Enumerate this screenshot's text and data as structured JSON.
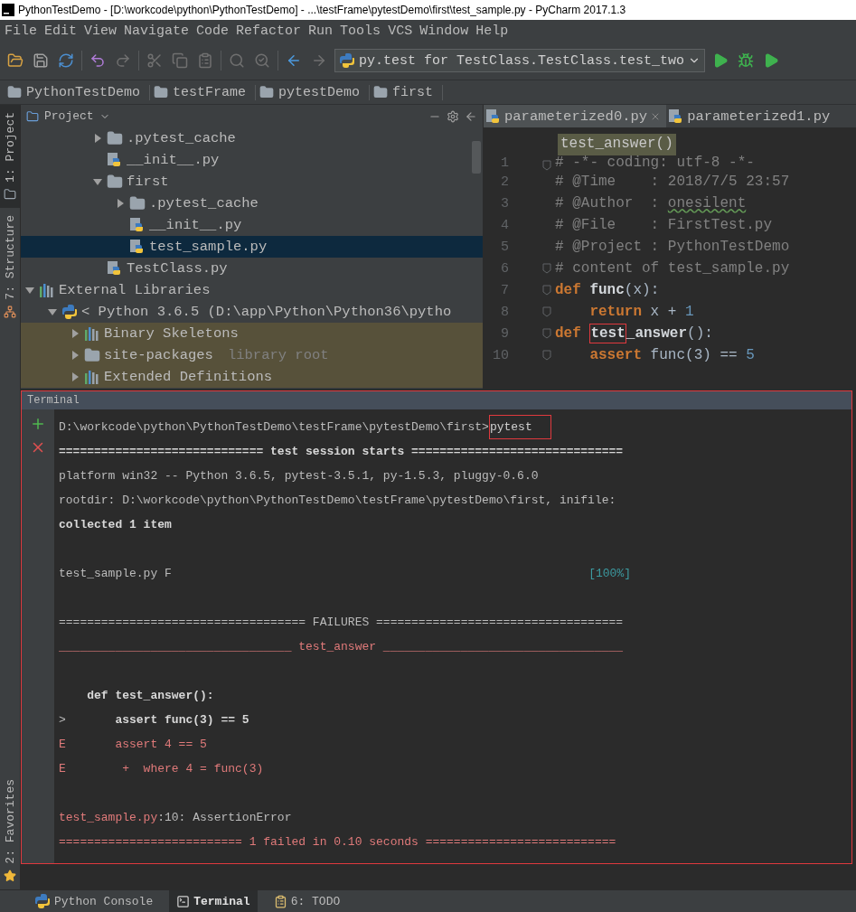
{
  "window": {
    "title": "PythonTestDemo - [D:\\workcode\\python\\PythonTestDemo] - ...\\testFrame\\pytestDemo\\first\\test_sample.py - PyCharm 2017.1.3"
  },
  "menu": [
    "File",
    "Edit",
    "View",
    "Navigate",
    "Code",
    "Refactor",
    "Run",
    "Tools",
    "VCS",
    "Window",
    "Help"
  ],
  "toolbar": {
    "run_config": "py.test for TestClass.TestClass.test_two"
  },
  "breadcrumbs": [
    "PythonTestDemo",
    "testFrame",
    "pytestDemo",
    "first"
  ],
  "side_tabs": [
    {
      "label": "1: Project",
      "selected": true
    },
    {
      "label": "7: Structure",
      "selected": false
    },
    {
      "label": "2: Favorites",
      "selected": false
    }
  ],
  "project": {
    "title": "Project",
    "tree": [
      {
        "children": [
          {
            "children": [
              {
                "children": [
                  {
                    "label": ".pytest_cache",
                    "kind": "folder",
                    "expanded": false,
                    "selected": false,
                    "shaded": false
                  },
                  {
                    "label": "__init__.py",
                    "kind": "python",
                    "selected": false,
                    "shaded": false
                  },
                  {
                    "label": "first",
                    "kind": "package",
                    "expanded": true,
                    "selected": false,
                    "shaded": false,
                    "children": [
                      {
                        "label": ".pytest_cache",
                        "kind": "folder",
                        "expanded": false,
                        "selected": false,
                        "shaded": false
                      },
                      {
                        "label": "__init__.py",
                        "kind": "python",
                        "selected": false,
                        "shaded": false
                      },
                      {
                        "label": "test_sample.py",
                        "kind": "python",
                        "selected": true,
                        "shaded": false
                      }
                    ]
                  },
                  {
                    "label": "TestClass.py",
                    "kind": "python",
                    "selected": false,
                    "shaded": false
                  }
                ]
              }
            ]
          }
        ]
      },
      {
        "label": "External Libraries",
        "kind": "libraries",
        "expanded": true,
        "selected": false,
        "shaded": false,
        "children": [
          {
            "label": "< Python 3.6.5 (D:\\app\\Python\\Python36\\pytho",
            "kind": "sdk",
            "expanded": true,
            "selected": false,
            "shaded": false,
            "children": [
              {
                "label": "Binary Skeletons",
                "kind": "libraries",
                "expanded": false,
                "selected": false,
                "shaded": true
              },
              {
                "label": "site-packages",
                "note": "library root",
                "kind": "folder",
                "expanded": false,
                "selected": false,
                "shaded": true
              },
              {
                "label": "Extended Definitions",
                "kind": "libraries",
                "expanded": false,
                "selected": false,
                "shaded": true
              }
            ]
          }
        ]
      }
    ]
  },
  "editor": {
    "tabs": [
      {
        "label": "parameterized0.py",
        "selected": true
      },
      {
        "label": "parameterized1.py",
        "selected": false
      }
    ],
    "sticky_header": "test_answer()",
    "lines": [
      {
        "number": "1",
        "fold": true,
        "clipped": true,
        "segments": [
          {
            "text": "# -*- coding: utf-8 -*-",
            "kind": "comment"
          }
        ]
      },
      {
        "number": "2",
        "fold": false,
        "clipped": false,
        "segments": [
          {
            "text": "# @Time    : 2018/7/5 23:57",
            "kind": "comment"
          }
        ]
      },
      {
        "number": "3",
        "fold": false,
        "clipped": false,
        "segments": [
          {
            "text": "# @Author  : ",
            "kind": "comment"
          },
          {
            "text": "onesilent",
            "kind": "typo"
          }
        ]
      },
      {
        "number": "4",
        "fold": false,
        "clipped": false,
        "segments": [
          {
            "text": "# @File    : FirstTest.py",
            "kind": "comment"
          }
        ]
      },
      {
        "number": "5",
        "fold": false,
        "clipped": false,
        "segments": [
          {
            "text": "# @Project : PythonTestDemo",
            "kind": "comment"
          }
        ]
      },
      {
        "number": "6",
        "fold": true,
        "clipped": false,
        "segments": [
          {
            "text": "# content of test_sample.py",
            "kind": "comment"
          }
        ]
      },
      {
        "number": "7",
        "fold": true,
        "clipped": false,
        "segments": [
          {
            "text": "def",
            "kind": "keyword"
          },
          {
            "text": " func",
            "kind": "name"
          },
          {
            "text": "(x):",
            "kind": "plain"
          }
        ]
      },
      {
        "number": "8",
        "fold": true,
        "clipped": false,
        "segments": [
          {
            "text": "    return",
            "kind": "keyword"
          },
          {
            "text": " x + ",
            "kind": "plain"
          },
          {
            "text": "1",
            "kind": "number"
          }
        ]
      },
      {
        "number": "9",
        "fold": true,
        "clipped": false,
        "segments": [
          {
            "text": "def ",
            "kind": "keyword"
          },
          {
            "text": "test",
            "kind": "boxed"
          },
          {
            "text": "_answer",
            "kind": "name"
          },
          {
            "text": "():",
            "kind": "plain"
          }
        ]
      },
      {
        "number": "10",
        "fold": true,
        "clipped": false,
        "segments": [
          {
            "text": "    assert",
            "kind": "keyword"
          },
          {
            "text": " func(3) == ",
            "kind": "plain"
          },
          {
            "text": "5",
            "kind": "number"
          }
        ]
      }
    ]
  },
  "terminal": {
    "title": "Terminal",
    "boxed": true,
    "lines": [
      {
        "kind": "text",
        "segments": [
          {
            "text": "D:\\workcode\\python\\PythonTestDemo\\testFrame\\pytestDemo\\first>",
            "kind": "plain"
          },
          {
            "text": "pytest",
            "kind": "boxed"
          }
        ]
      },
      {
        "kind": "text",
        "segments": [
          {
            "text": "============================= test session starts ==============================",
            "kind": "bold"
          }
        ]
      },
      {
        "kind": "text",
        "segments": [
          {
            "text": "platform win32 -- Python 3.6.5, pytest-3.5.1, py-1.5.3, pluggy-0.6.0",
            "kind": "plain"
          }
        ]
      },
      {
        "kind": "text",
        "segments": [
          {
            "text": "rootdir: D:\\workcode\\python\\PythonTestDemo\\testFrame\\pytestDemo\\first, inifile:",
            "kind": "plain"
          }
        ]
      },
      {
        "kind": "text",
        "segments": [
          {
            "text": "collected 1 item",
            "kind": "bold"
          }
        ]
      },
      {
        "kind": "blank"
      },
      {
        "kind": "text",
        "segments": [
          {
            "text": "test_sample.py F",
            "kind": "plain"
          }
        ],
        "right": "[100%]"
      },
      {
        "kind": "blank"
      },
      {
        "kind": "text",
        "segments": [
          {
            "text": "=================================== FAILURES ===================================",
            "kind": "plain"
          }
        ]
      },
      {
        "kind": "text",
        "segments": [
          {
            "text": "_________________________________ test_answer __________________________________",
            "kind": "red"
          }
        ]
      },
      {
        "kind": "blank"
      },
      {
        "kind": "text",
        "segments": [
          {
            "text": "    def test_answer():",
            "kind": "bold"
          }
        ]
      },
      {
        "kind": "text",
        "segments": [
          {
            "text": ">",
            "kind": "plain"
          },
          {
            "text": "       assert func(3) == 5",
            "kind": "bold"
          }
        ]
      },
      {
        "kind": "text",
        "segments": [
          {
            "text": "E       assert 4 == 5",
            "kind": "red"
          }
        ]
      },
      {
        "kind": "text",
        "segments": [
          {
            "text": "E        +  where 4 = func(3)",
            "kind": "red"
          }
        ]
      },
      {
        "kind": "blank"
      },
      {
        "kind": "text",
        "segments": [
          {
            "text": "test_sample.py",
            "kind": "red"
          },
          {
            "text": ":10: AssertionError",
            "kind": "plain"
          }
        ]
      },
      {
        "kind": "text",
        "segments": [
          {
            "text": "========================== 1 failed in 0.10 seconds ===========================",
            "kind": "red"
          }
        ]
      }
    ]
  },
  "status_tabs": [
    {
      "label": "Python Console",
      "selected": false
    },
    {
      "label": "Terminal",
      "selected": true
    },
    {
      "label": "6: TODO",
      "selected": false
    }
  ]
}
